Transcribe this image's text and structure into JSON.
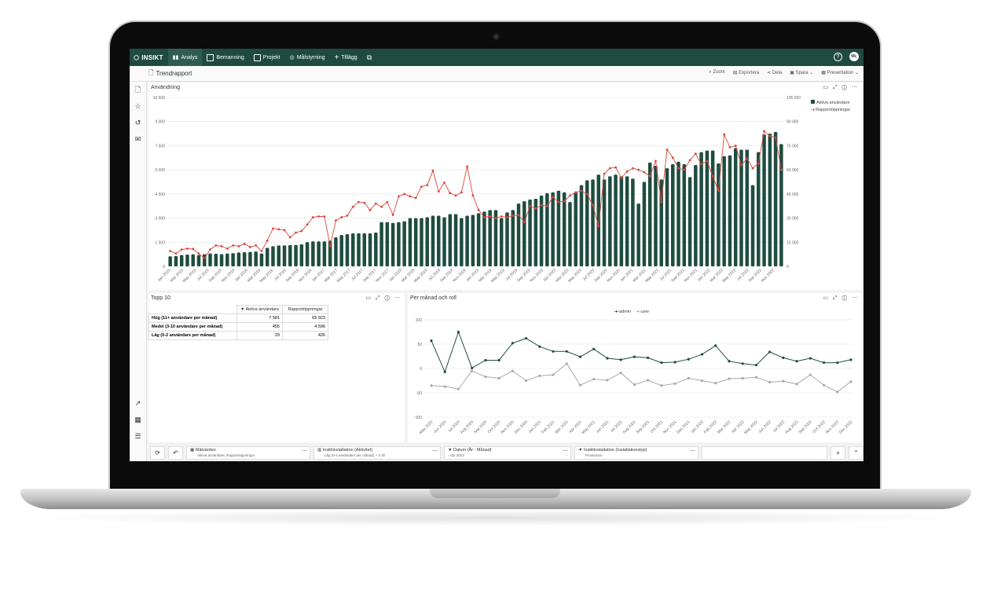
{
  "nav": {
    "logo": "INSIKT",
    "items": [
      {
        "label": "Analys",
        "active": true
      },
      {
        "label": "Bemanning"
      },
      {
        "label": "Projekt"
      },
      {
        "label": "Målstyrning"
      },
      {
        "label": "Tillägg"
      }
    ],
    "help": "?",
    "avatar": "ML"
  },
  "report": {
    "title": "Trendrapport",
    "tools": [
      "Zoom",
      "Exportera",
      "Dela",
      "Spara",
      "Presentation"
    ]
  },
  "panels": {
    "main_title": "Användning",
    "top10_title": "Topp 10",
    "role_title": "Per månad och roll"
  },
  "colors": {
    "accent": "#1e4a3f",
    "bar": "#1f4d3f",
    "line_red": "#d9473d",
    "line_admin": "#1f4d3f",
    "line_user": "#a9a9a9"
  },
  "chart_data": [
    {
      "type": "bar",
      "title": "Användning",
      "legend_position": "top-right",
      "y_left_ticks": [
        "0",
        "1 500",
        "3 000",
        "4 500",
        "6 000",
        "7 500",
        "9 000",
        "10 500"
      ],
      "y_right_ticks": [
        "0",
        "15 000",
        "30 000",
        "45 000",
        "60 000",
        "75 000",
        "90 000",
        "105 000"
      ],
      "ylim_left": [
        0,
        10500
      ],
      "ylim_right": [
        0,
        105000
      ],
      "x_ticks": [
        "Jan 2015",
        "Mar 2015",
        "May 2015",
        "Jul 2015",
        "Sep 2015",
        "Nov 2015",
        "Jan 2016",
        "Mar 2016",
        "May 2016",
        "Jul 2016",
        "Sep 2016",
        "Nov 2016",
        "Jan 2017",
        "Mar 2017",
        "May 2017",
        "Jul 2017",
        "Sep 2017",
        "Nov 2017",
        "Jan 2018",
        "Mar 2018",
        "May 2018",
        "Jul 2018",
        "Sep 2018",
        "Nov 2018",
        "Jan 2019",
        "Mar 2019",
        "May 2019",
        "Jul 2019",
        "Sep 2019",
        "Nov 2019",
        "Jan 2020",
        "Mar 2020",
        "May 2020",
        "Jul 2020",
        "Sep 2020",
        "Nov 2020",
        "Jan 2021",
        "Mar 2021",
        "May 2021",
        "Jul 2021",
        "Sep 2021",
        "Nov 2021",
        "Jan 2022",
        "Mar 2022",
        "May 2022",
        "Jul 2022",
        "Sep 2022",
        "Nov 2022"
      ],
      "series": [
        {
          "name": "Aktiva användare",
          "axis": "left",
          "kind": "bar",
          "values": [
            620,
            640,
            700,
            730,
            750,
            700,
            760,
            800,
            780,
            760,
            800,
            820,
            860,
            880,
            900,
            920,
            800,
            1150,
            1250,
            1300,
            1300,
            1320,
            1330,
            1370,
            1500,
            1550,
            1550,
            1550,
            1600,
            1800,
            1950,
            2000,
            2050,
            2050,
            2050,
            2050,
            2100,
            2750,
            2750,
            2700,
            2750,
            2800,
            3000,
            3000,
            3000,
            3050,
            3150,
            3150,
            3050,
            3250,
            3250,
            3000,
            3150,
            3200,
            3300,
            3400,
            3500,
            3500,
            3000,
            3350,
            3500,
            3900,
            4050,
            4150,
            4200,
            4400,
            4550,
            4600,
            4700,
            4600,
            4000,
            4600,
            5050,
            5350,
            5400,
            5700,
            5400,
            5600,
            5700,
            5600,
            5600,
            5450,
            3900,
            5250,
            6450,
            6250,
            5400,
            6100,
            6350,
            6500,
            6350,
            5550,
            6300,
            7100,
            7200,
            7200,
            6400,
            6850,
            6900,
            7350,
            7250,
            7250,
            5050,
            7100,
            8200,
            8250,
            8350,
            7600
          ]
        },
        {
          "name": "Rapportöppningar",
          "axis": "right",
          "kind": "line",
          "values": [
            9500,
            8000,
            10500,
            11000,
            10800,
            8000,
            5000,
            10500,
            13000,
            12500,
            11000,
            13000,
            12500,
            14000,
            12000,
            13000,
            9500,
            16000,
            23500,
            23000,
            22500,
            18000,
            21000,
            22000,
            26000,
            30500,
            31000,
            31000,
            12500,
            28500,
            30500,
            31500,
            37000,
            40000,
            39500,
            35000,
            39000,
            37000,
            40000,
            32000,
            43500,
            45000,
            43500,
            42500,
            49500,
            50500,
            59500,
            46500,
            52000,
            45500,
            44000,
            46000,
            62000,
            44000,
            35000,
            30500,
            31000,
            30000,
            31000,
            30500,
            31500,
            32000,
            27500,
            37500,
            36000,
            38000,
            37500,
            43000,
            40000,
            40500,
            44000,
            46000,
            47000,
            45000,
            38000,
            25000,
            57500,
            61000,
            61500,
            55000,
            59000,
            61000,
            60000,
            58500,
            56000,
            65500,
            40000,
            72500,
            67500,
            61000,
            60000,
            66000,
            70000,
            63500,
            65500,
            56000,
            47000,
            82000,
            74000,
            75000,
            63000,
            67000,
            61000,
            64000,
            84000,
            81000,
            80000,
            60000
          ]
        }
      ]
    },
    {
      "type": "table",
      "title": "Topp 10",
      "columns": [
        "Aktiva användare",
        "Rapportöppningar"
      ],
      "rows": [
        {
          "label": "Hög (11+ användare per månad)",
          "values": [
            "7 581",
            "65 923"
          ]
        },
        {
          "label": "Medel (3-10 användare per månad)",
          "values": [
            "455",
            "4 596"
          ]
        },
        {
          "label": "Låg (0-2 användare per månad)",
          "values": [
            "29",
            "426"
          ]
        }
      ]
    },
    {
      "type": "line",
      "title": "Per månad och roll",
      "legend_position": "top",
      "ylim": [
        -100,
        100
      ],
      "y_ticks": [
        "100",
        "50",
        "0",
        "-50",
        "-100"
      ],
      "x_ticks": [
        "May 2020",
        "Jun 2020",
        "Jul 2020",
        "Aug 2020",
        "Sep 2020",
        "Oct 2020",
        "Nov 2020",
        "Dec 2020",
        "Jan 2021",
        "Feb 2021",
        "Mar 2021",
        "Apr 2021",
        "May 2021",
        "Jun 2021",
        "Jul 2021",
        "Aug 2021",
        "Sep 2021",
        "Oct 2021",
        "Nov 2021",
        "Dec 2021",
        "Jan 2022",
        "Feb 2022",
        "Mar 2022",
        "Apr 2022",
        "May 2022",
        "Jun 2022",
        "Jul 2022",
        "Aug 2022",
        "Sep 2022",
        "Oct 2022",
        "Nov 2022",
        "Dec 2022"
      ],
      "series": [
        {
          "name": "admin",
          "values": [
            57,
            -7,
            75,
            1,
            17,
            17,
            52,
            62,
            45,
            35,
            35,
            24,
            40,
            21,
            18,
            24,
            22,
            12,
            13,
            19,
            29,
            47,
            15,
            10,
            7,
            34,
            22,
            15,
            21,
            12,
            12,
            18
          ]
        },
        {
          "name": "user",
          "values": [
            -35,
            -37,
            -42,
            -5,
            -17,
            -20,
            -5,
            -25,
            -15,
            -13,
            10,
            -34,
            -22,
            -24,
            -9,
            -33,
            -24,
            -35,
            -31,
            -20,
            -25,
            -30,
            -21,
            -20,
            -18,
            -28,
            -26,
            -32,
            -13,
            -34,
            -48,
            -27
          ]
        }
      ]
    }
  ],
  "filters": [
    {
      "title": "Mätvärden",
      "value": "Aktiva användare, Rapportöppningar"
    },
    {
      "title": "Insiktinstallation (Aktivitet)",
      "value": "Låg (0-2 användare per månad) + 2 till"
    },
    {
      "title": "Datum (År - Månad)",
      "value": "Apr 2023"
    },
    {
      "title": "Insiktinstallation (Installationstyp)",
      "value": "Production"
    }
  ],
  "icons": [
    "file-icon",
    "star-icon",
    "history-icon",
    "mail-icon",
    "axis-icon",
    "calculator-icon",
    "sliders-icon",
    "refresh-icon",
    "undo-icon",
    "plus-icon",
    "chevron-up-icon"
  ]
}
